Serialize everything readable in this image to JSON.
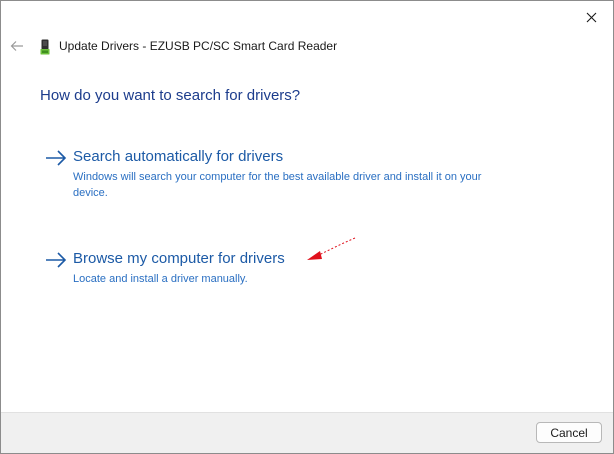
{
  "window": {
    "title": "Update Drivers - EZUSB PC/SC Smart Card Reader",
    "close_icon": "close-icon",
    "back_icon": "back-arrow-icon",
    "device_icon": "smart-card-reader-icon"
  },
  "main": {
    "heading": "How do you want to search for drivers?",
    "options": [
      {
        "title": "Search automatically for drivers",
        "description": "Windows will search your computer for the best available driver and install it on your device.",
        "icon": "arrow-right-icon"
      },
      {
        "title": "Browse my computer for drivers",
        "description": "Locate and install a driver manually.",
        "icon": "arrow-right-icon"
      }
    ]
  },
  "footer": {
    "cancel_label": "Cancel"
  },
  "colors": {
    "heading": "#1c3c8c",
    "link": "#1c5aa6",
    "description": "#2a6fc2",
    "annotation_arrow": "#e0101c",
    "footer_bg": "#f0f0f0"
  }
}
